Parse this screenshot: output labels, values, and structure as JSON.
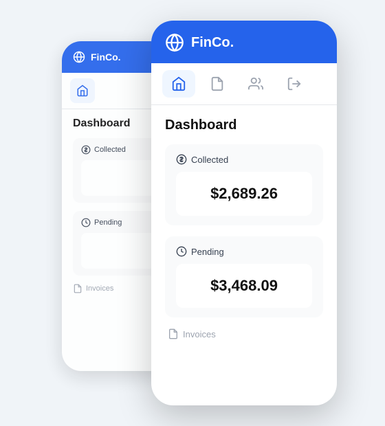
{
  "app": {
    "name": "FinCo.",
    "logo_aria": "globe-icon"
  },
  "nav": {
    "items": [
      {
        "id": "home",
        "label": "Home",
        "active": true
      },
      {
        "id": "docs",
        "label": "Documents",
        "active": false
      },
      {
        "id": "users",
        "label": "Users",
        "active": false
      },
      {
        "id": "logout",
        "label": "Logout",
        "active": false
      }
    ]
  },
  "dashboard": {
    "title": "Dashboard",
    "collected": {
      "label": "Collected",
      "value": "$2,689.26"
    },
    "pending": {
      "label": "Pending",
      "value": "$3,468.09"
    },
    "invoices": {
      "label": "Invoices"
    }
  }
}
